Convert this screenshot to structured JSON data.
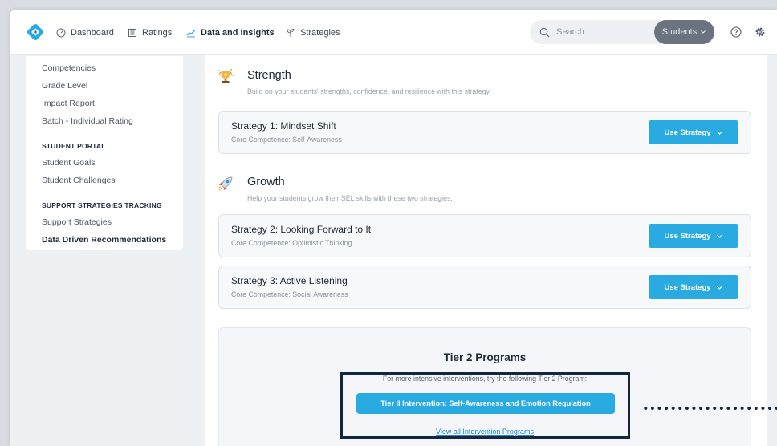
{
  "nav": {
    "dashboard": "Dashboard",
    "ratings": "Ratings",
    "data_insights": "Data and Insights",
    "strategies": "Strategies",
    "search_placeholder": "Search",
    "role_select": "Students"
  },
  "sidebar": {
    "links_top": [
      "Competencies",
      "Grade Level",
      "Impact Report",
      "Batch - Individual Rating"
    ],
    "student_portal_heading": "STUDENT PORTAL",
    "student_portal_links": [
      "Student Goals",
      "Student Challenges"
    ],
    "support_heading": "SUPPORT STRATEGIES TRACKING",
    "support_links": [
      "Support Strategies",
      "Data Driven Recommendations"
    ]
  },
  "sections": {
    "strength": {
      "title": "Strength",
      "description": "Build on your students' strengths, confidence, and resilience with this strategy.",
      "icon": "trophy-icon"
    },
    "growth": {
      "title": "Growth",
      "description": "Help your students grow their SEL skills with these two strategies.",
      "icon": "rocket-icon"
    }
  },
  "strategies": [
    {
      "title": "Strategy 1: Mindset Shift",
      "competence": "Core Competence: Self-Awareness",
      "button": "Use Strategy"
    },
    {
      "title": "Strategy 2: Looking Forward to It",
      "competence": "Core Competence: Optimistic Thinking",
      "button": "Use Strategy"
    },
    {
      "title": "Strategy 3: Active Listening",
      "competence": "Core Competence: Social Awareness",
      "button": "Use Strategy"
    }
  ],
  "tier2": {
    "title": "Tier 2 Programs",
    "description": "For more intensive interventions, try the following Tier 2 Program:",
    "button": "Tier II Intervention: Self-Awareness and Emotion Regulation",
    "link": "View all Intervention Programs"
  },
  "colors": {
    "accent": "#29abe2",
    "highlight_border": "#15263f",
    "link": "#1e88d0",
    "role_select_bg": "#6b7280"
  }
}
